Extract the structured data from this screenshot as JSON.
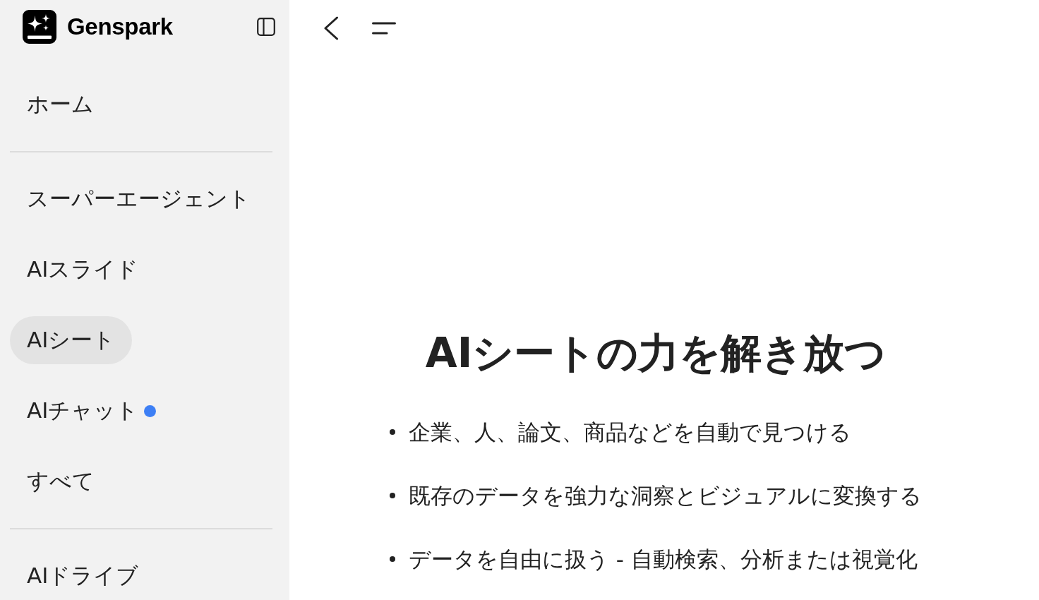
{
  "sidebar": {
    "brand": "Genspark",
    "sections": [
      {
        "items": [
          {
            "label": "ホーム",
            "selected": false,
            "dot": false
          }
        ]
      },
      {
        "items": [
          {
            "label": "スーパーエージェント",
            "selected": false,
            "dot": false
          },
          {
            "label": "AIスライド",
            "selected": false,
            "dot": false
          },
          {
            "label": "AIシート",
            "selected": true,
            "dot": false
          },
          {
            "label": "AIチャット",
            "selected": false,
            "dot": true
          },
          {
            "label": "すべて",
            "selected": false,
            "dot": false
          }
        ]
      },
      {
        "items": [
          {
            "label": "AIドライブ",
            "selected": false,
            "dot": false
          }
        ]
      }
    ]
  },
  "main": {
    "title": "AIシートの力を解き放つ",
    "bullets": [
      "企業、人、論文、商品などを自動で見つける",
      "既存のデータを強力な洞察とビジュアルに変換する",
      "データを自由に扱う - 自動検索、分析または視覚化"
    ]
  }
}
